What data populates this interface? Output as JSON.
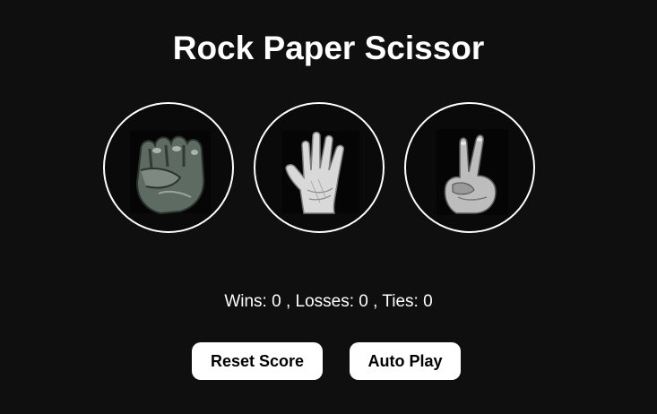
{
  "title": "Rock Paper Scissor",
  "moves": [
    {
      "id": "rock",
      "icon": "rock-fist-icon"
    },
    {
      "id": "paper",
      "icon": "paper-open-hand-icon"
    },
    {
      "id": "scissors",
      "icon": "scissors-two-fingers-icon"
    }
  ],
  "score": {
    "text": "Wins: 0 , Losses: 0 , Ties: 0",
    "wins": 0,
    "losses": 0,
    "ties": 0
  },
  "buttons": {
    "reset_label": "Reset Score",
    "autoplay_label": "Auto Play"
  },
  "colors": {
    "background": "#0f0f0f",
    "text": "#ffffff",
    "button_bg": "#ffffff",
    "button_text": "#000000"
  }
}
